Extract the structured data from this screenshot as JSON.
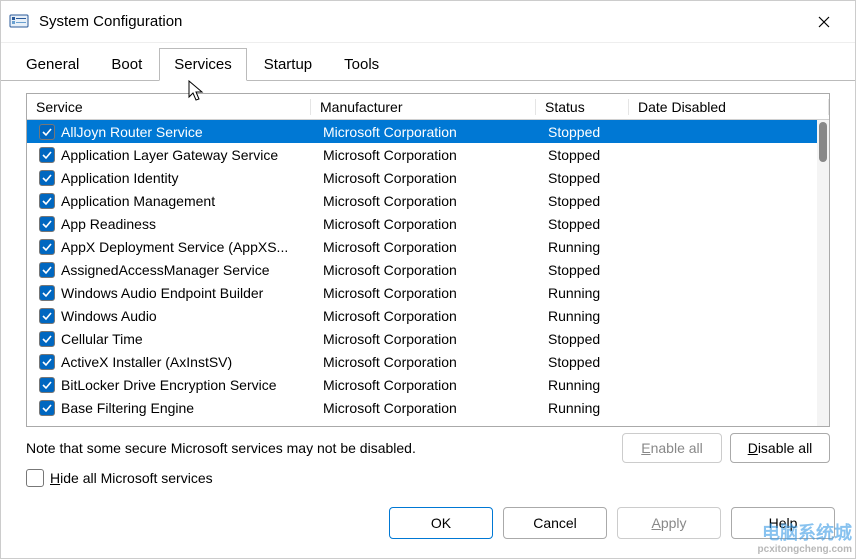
{
  "window": {
    "title": "System Configuration"
  },
  "tabs": [
    {
      "label": "General",
      "active": false
    },
    {
      "label": "Boot",
      "active": false
    },
    {
      "label": "Services",
      "active": true
    },
    {
      "label": "Startup",
      "active": false
    },
    {
      "label": "Tools",
      "active": false
    }
  ],
  "columns": {
    "service": "Service",
    "manufacturer": "Manufacturer",
    "status": "Status",
    "date_disabled": "Date Disabled"
  },
  "services": [
    {
      "checked": true,
      "selected": true,
      "name": "AllJoyn Router Service",
      "manufacturer": "Microsoft Corporation",
      "status": "Stopped",
      "date_disabled": ""
    },
    {
      "checked": true,
      "selected": false,
      "name": "Application Layer Gateway Service",
      "manufacturer": "Microsoft Corporation",
      "status": "Stopped",
      "date_disabled": ""
    },
    {
      "checked": true,
      "selected": false,
      "name": "Application Identity",
      "manufacturer": "Microsoft Corporation",
      "status": "Stopped",
      "date_disabled": ""
    },
    {
      "checked": true,
      "selected": false,
      "name": "Application Management",
      "manufacturer": "Microsoft Corporation",
      "status": "Stopped",
      "date_disabled": ""
    },
    {
      "checked": true,
      "selected": false,
      "name": "App Readiness",
      "manufacturer": "Microsoft Corporation",
      "status": "Stopped",
      "date_disabled": ""
    },
    {
      "checked": true,
      "selected": false,
      "name": "AppX Deployment Service (AppXS...",
      "manufacturer": "Microsoft Corporation",
      "status": "Running",
      "date_disabled": ""
    },
    {
      "checked": true,
      "selected": false,
      "name": "AssignedAccessManager Service",
      "manufacturer": "Microsoft Corporation",
      "status": "Stopped",
      "date_disabled": ""
    },
    {
      "checked": true,
      "selected": false,
      "name": "Windows Audio Endpoint Builder",
      "manufacturer": "Microsoft Corporation",
      "status": "Running",
      "date_disabled": ""
    },
    {
      "checked": true,
      "selected": false,
      "name": "Windows Audio",
      "manufacturer": "Microsoft Corporation",
      "status": "Running",
      "date_disabled": ""
    },
    {
      "checked": true,
      "selected": false,
      "name": "Cellular Time",
      "manufacturer": "Microsoft Corporation",
      "status": "Stopped",
      "date_disabled": ""
    },
    {
      "checked": true,
      "selected": false,
      "name": "ActiveX Installer (AxInstSV)",
      "manufacturer": "Microsoft Corporation",
      "status": "Stopped",
      "date_disabled": ""
    },
    {
      "checked": true,
      "selected": false,
      "name": "BitLocker Drive Encryption Service",
      "manufacturer": "Microsoft Corporation",
      "status": "Running",
      "date_disabled": ""
    },
    {
      "checked": true,
      "selected": false,
      "name": "Base Filtering Engine",
      "manufacturer": "Microsoft Corporation",
      "status": "Running",
      "date_disabled": ""
    }
  ],
  "note": "Note that some secure Microsoft services may not be disabled.",
  "buttons": {
    "enable_all": "Enable all",
    "disable_all": "Disable all",
    "ok": "OK",
    "cancel": "Cancel",
    "apply": "Apply",
    "help": "Help"
  },
  "hide_ms_label": "Hide all Microsoft services",
  "hide_ms_checked": false,
  "watermark": {
    "main": "电脑系统城",
    "sub": "pcxitongcheng.com"
  }
}
